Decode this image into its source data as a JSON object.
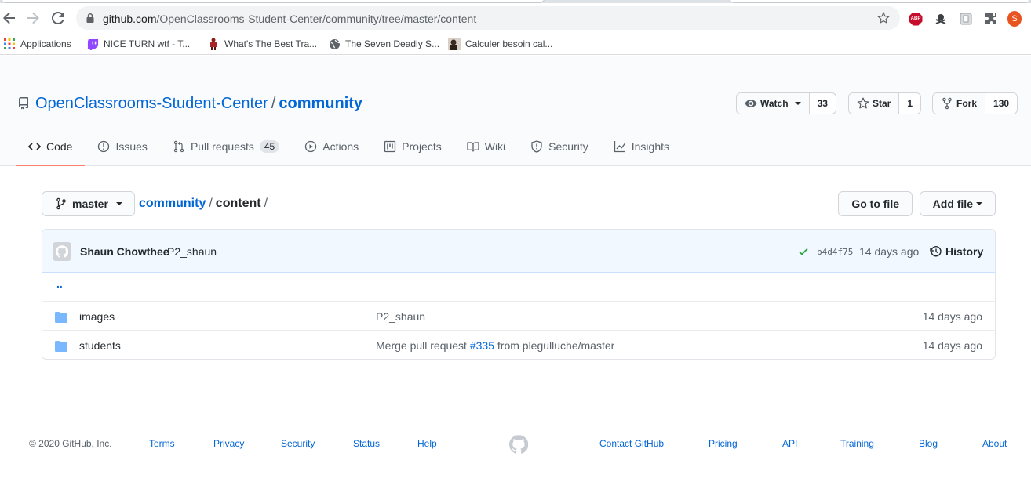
{
  "browser": {
    "url_host": "github.com",
    "url_path": "/OpenClassrooms-Student-Center/community/tree/master/content",
    "profile_initial": "S",
    "extensions": [
      "abp-icon",
      "pirate-icon",
      "extension-square-icon",
      "puzzle-icon"
    ],
    "bookmarks": [
      {
        "label": "Applications",
        "icon": "apps-grid-icon"
      },
      {
        "label": "NICE TURN wtf - T...",
        "icon": "twitch-icon"
      },
      {
        "label": "What's The Best Tra...",
        "icon": "figure-icon"
      },
      {
        "label": "The Seven Deadly S...",
        "icon": "globe-icon"
      },
      {
        "label": "Calculer besoin cal...",
        "icon": "photo-icon"
      }
    ]
  },
  "repo": {
    "owner": "OpenClassrooms-Student-Center",
    "separator": "/",
    "name": "community",
    "watch": {
      "label": "Watch",
      "count": "33"
    },
    "star": {
      "label": "Star",
      "count": "1"
    },
    "fork": {
      "label": "Fork",
      "count": "130"
    }
  },
  "tabs": [
    {
      "label": "Code",
      "icon": "code-icon",
      "selected": true
    },
    {
      "label": "Issues",
      "icon": "issue-icon"
    },
    {
      "label": "Pull requests",
      "icon": "pull-request-icon",
      "counter": "45"
    },
    {
      "label": "Actions",
      "icon": "play-icon"
    },
    {
      "label": "Projects",
      "icon": "project-icon"
    },
    {
      "label": "Wiki",
      "icon": "book-icon"
    },
    {
      "label": "Security",
      "icon": "shield-icon"
    },
    {
      "label": "Insights",
      "icon": "graph-icon"
    }
  ],
  "file_nav": {
    "branch": "master",
    "breadcrumb_root": "community",
    "breadcrumb_sep": "/",
    "breadcrumb_current": "content",
    "go_to_file": "Go to file",
    "add_file": "Add file"
  },
  "commit": {
    "author": "Shaun Chowthee",
    "message": "P2_shaun",
    "sha": "b4d4f75",
    "age": "14 days ago",
    "history": "History"
  },
  "files": {
    "up": "..",
    "rows": [
      {
        "name": "images",
        "message": "P2_shaun",
        "age": "14 days ago"
      },
      {
        "name": "students",
        "message_prefix": "Merge pull request",
        "message_link": "#335",
        "message_suffix": "from plegulluche/master",
        "age": "14 days ago"
      }
    ]
  },
  "footer": {
    "copyright": "© 2020 GitHub, Inc.",
    "links_left": [
      "Terms",
      "Privacy",
      "Security",
      "Status",
      "Help"
    ],
    "links_right": [
      "Contact GitHub",
      "Pricing",
      "API",
      "Training",
      "Blog",
      "About"
    ]
  },
  "colors": {
    "link": "#0366d6",
    "tab_underline": "#f9826c",
    "commit_bg": "#f1f8ff",
    "folder": "#79b8ff",
    "success": "#28a745"
  }
}
